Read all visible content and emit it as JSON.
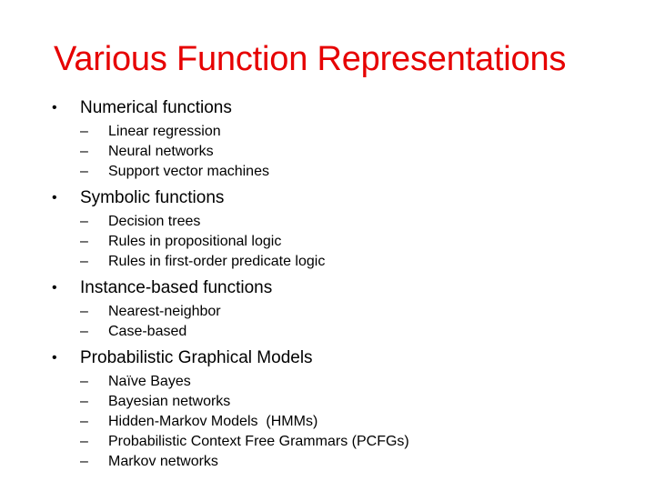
{
  "slide": {
    "title": "Various Function Representations",
    "bullet_glyph": "•",
    "dash_glyph": "–",
    "sections": [
      {
        "label": "Numerical functions",
        "items": [
          "Linear regression",
          "Neural networks",
          "Support vector machines"
        ]
      },
      {
        "label": "Symbolic functions",
        "items": [
          "Decision trees",
          "Rules in propositional logic",
          "Rules in first-order predicate logic"
        ]
      },
      {
        "label": "Instance-based functions",
        "items": [
          "Nearest-neighbor",
          "Case-based"
        ]
      },
      {
        "label": "Probabilistic Graphical Models",
        "items": [
          "Naïve Bayes",
          "Bayesian networks",
          "Hidden-Markov Models  (HMMs)",
          "Probabilistic Context Free Grammars (PCFGs)",
          "Markov networks"
        ]
      }
    ]
  },
  "colors": {
    "title": "#e60000",
    "text": "#000000",
    "background": "#ffffff"
  }
}
